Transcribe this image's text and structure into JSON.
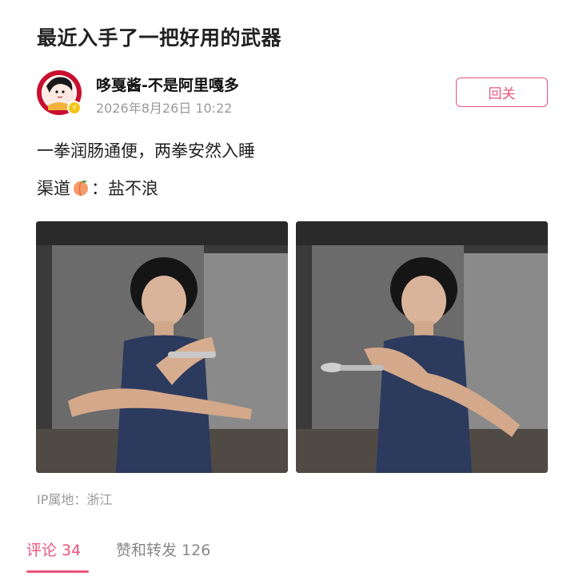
{
  "post": {
    "title": "最近入手了一把好用的武器",
    "author": {
      "name": "哆戛酱-不是阿里嘎多",
      "timestamp": "2026年8月26日 10:22",
      "avatar_icon": "avatar-icon",
      "verified_icon": "verified-badge-icon"
    },
    "follow_button_label": "回关",
    "content": {
      "line1": "一拳润肠通便，两拳安然入睡",
      "line2_prefix": "渠道",
      "line2_emoji": "peach-emoji",
      "line2_suffix": "：盐不浪"
    },
    "images": [
      {
        "name": "photo-1"
      },
      {
        "name": "photo-2"
      }
    ],
    "ip_location": "IP属地：浙江"
  },
  "tabs": {
    "comments_label": "评论 34",
    "likes_label": "赞和转发 126"
  },
  "colors": {
    "accent": "#e8557c",
    "text_primary": "#222222",
    "text_secondary": "#999999",
    "avatar_ring": "#c8102e",
    "verified_badge": "#f5c518"
  }
}
